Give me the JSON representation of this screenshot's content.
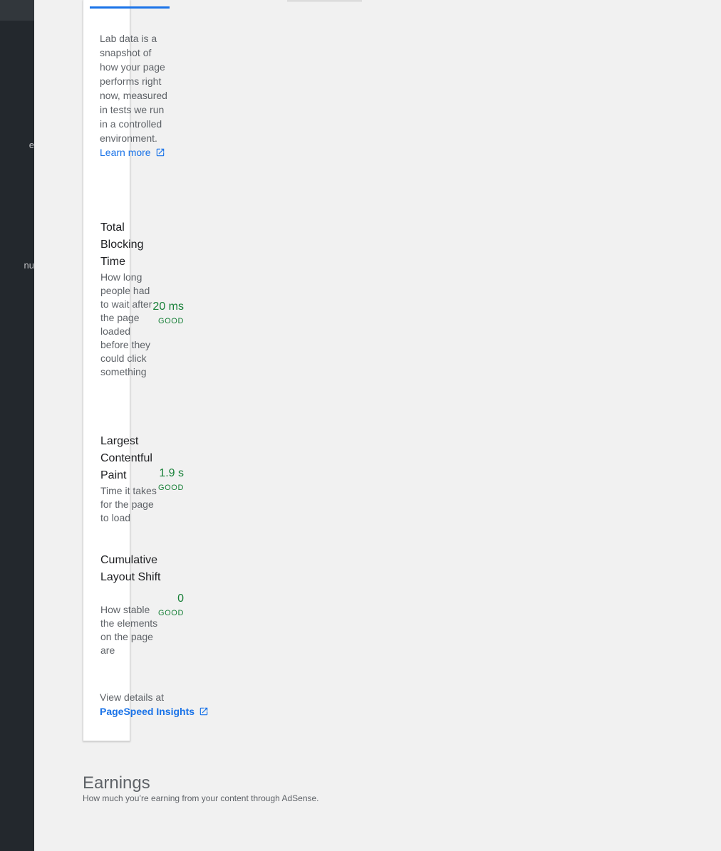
{
  "sidebar": {
    "clipped_labels": [
      "e",
      "nu"
    ]
  },
  "lab_data": {
    "intro_text": "Lab data is a snapshot of how your page performs right now, measured in tests we run in a controlled environment.",
    "learn_more_label": "Learn more"
  },
  "metrics": [
    {
      "name": "Total Blocking Time",
      "description": "How long people had to wait after the page loaded before they could click something",
      "value": "20 ms",
      "status": "GOOD"
    },
    {
      "name": "Largest Contentful Paint",
      "description": "Time it takes for the page to load",
      "value": "1.9 s",
      "status": "GOOD"
    },
    {
      "name": "Cumulative Layout Shift",
      "description": "How stable the elements on the page are",
      "value": "0",
      "status": "GOOD"
    }
  ],
  "details": {
    "prefix": "View details at",
    "link_label": "PageSpeed Insights"
  },
  "earnings": {
    "title": "Earnings",
    "subtitle": "How much you’re earning from your content through AdSense."
  },
  "colors": {
    "good": "#188038",
    "link": "#1a73e8",
    "sidebar": "#23282d"
  }
}
